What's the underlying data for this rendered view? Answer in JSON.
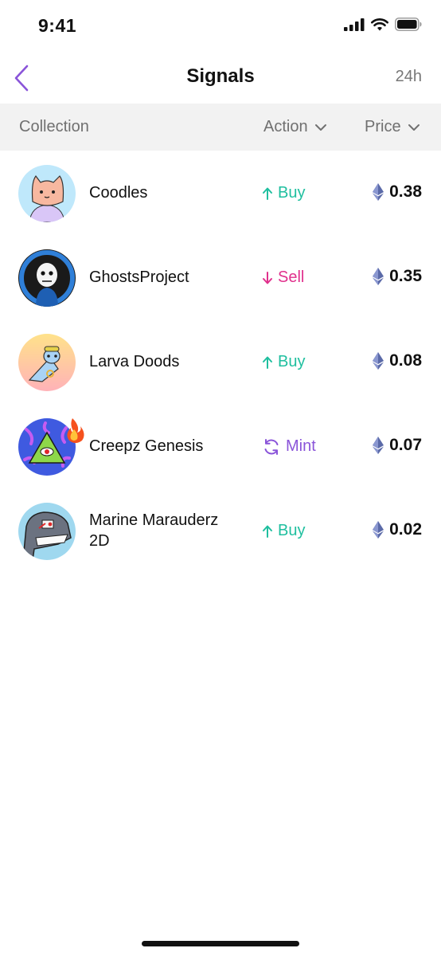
{
  "status_bar": {
    "time": "9:41"
  },
  "header": {
    "title": "Signals",
    "period": "24h"
  },
  "columns": {
    "collection": "Collection",
    "action": "Action",
    "price": "Price"
  },
  "rows": [
    {
      "name": "Coodles",
      "action": "Buy",
      "action_type": "buy",
      "price": "0.38"
    },
    {
      "name": "GhostsProject",
      "action": "Sell",
      "action_type": "sell",
      "price": "0.35"
    },
    {
      "name": "Larva Doods",
      "action": "Buy",
      "action_type": "buy",
      "price": "0.08"
    },
    {
      "name": "Creepz Genesis",
      "action": "Mint",
      "action_type": "mint",
      "price": "0.07"
    },
    {
      "name": "Marine Marauderz 2D",
      "action": "Buy",
      "action_type": "buy",
      "price": "0.02"
    }
  ],
  "colors": {
    "accent": "#8a54d9",
    "buy": "#1fbf9f",
    "sell": "#e0308c",
    "mint": "#8a54d9",
    "eth": "#5b6aa8"
  },
  "icons": {
    "back": "chevron-left-icon",
    "sort": "chevron-down-icon",
    "buy": "arrow-up-icon",
    "sell": "arrow-down-icon",
    "mint": "refresh-icon",
    "price": "ethereum-icon",
    "trending": "fire-icon"
  }
}
